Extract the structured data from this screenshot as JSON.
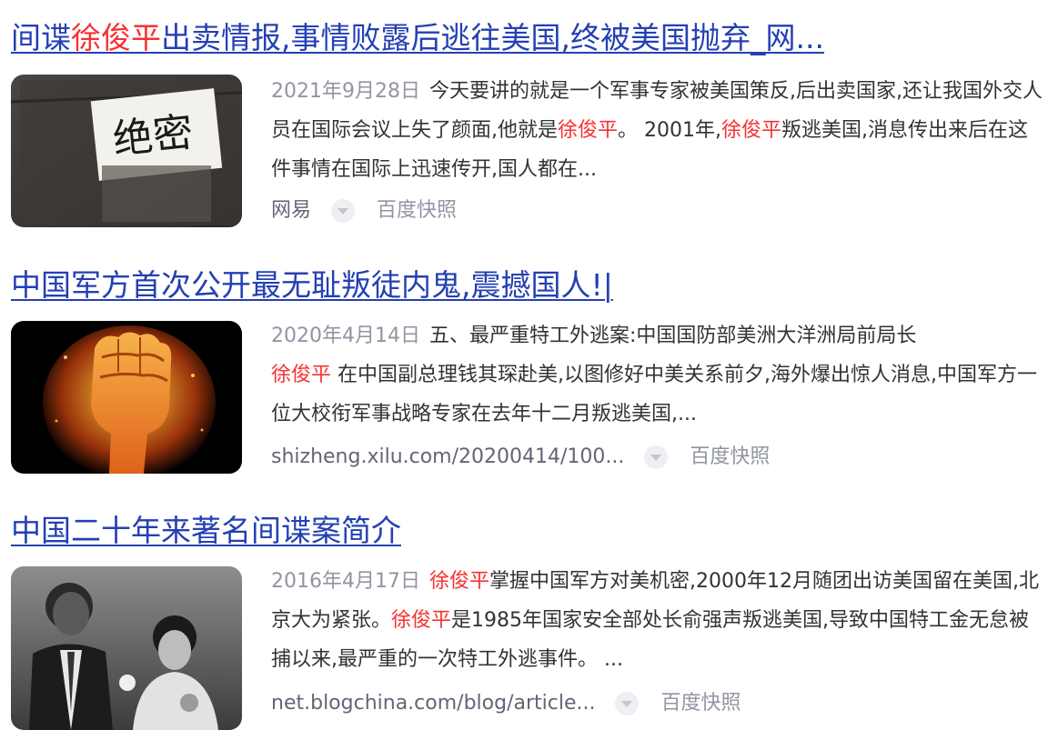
{
  "results": [
    {
      "title_pre": "间谍",
      "title_hl": "徐俊平",
      "title_post": "出卖情报,事情败露后逃往美国,终被美国抛弃_网...",
      "thumb_text": "绝密",
      "date": "2021年9月28日",
      "snippet_1": "今天要讲的就是一个军事专家被美国策反,后出卖国家,还让我国外交人员在国际会议上失了颜面,他就是",
      "snippet_hl_1": "徐俊平",
      "snippet_2": "。 2001年,",
      "snippet_hl_2": "徐俊平",
      "snippet_3": "叛逃美国,消息传出来后在这件事情在国际上迅速传开,国人都在...",
      "source": "网易",
      "snapshot": "百度快照"
    },
    {
      "title": "中国军方首次公开最无耻叛徒内鬼,震撼国人!|",
      "date": "2020年4月14日",
      "snippet_1": "五、最严重特工外逃案:中国国防部美洲大洋洲局前局长",
      "snippet_hl_1": "徐俊平",
      "snippet_2": " 在中国副总理钱其琛赴美,以图修好中美关系前夕,海外爆出惊人消息,中国军方一位大校衔军事战略专家在去年十二月叛逃美国,...",
      "source": "shizheng.xilu.com/20200414/100...",
      "snapshot": "百度快照"
    },
    {
      "title": "中国二十年来著名间谍案简介",
      "date": "2016年4月17日",
      "snippet_hl_1": "徐俊平",
      "snippet_1": "掌握中国军方对美机密,2000年12月随团出访美国留在美国,北京大为紧张。",
      "snippet_hl_2": "徐俊平",
      "snippet_2": "是1985年国家安全部处长俞强声叛逃美国,导致中国特工金无怠被捕以来,最严重的一次特工外逃事件。 ...",
      "source": "net.blogchina.com/blog/article...",
      "snapshot": "百度快照"
    }
  ],
  "colors": {
    "link": "#2440b3",
    "highlight": "#f73131",
    "date": "#9195a3",
    "text": "#333333",
    "source": "#626675"
  }
}
